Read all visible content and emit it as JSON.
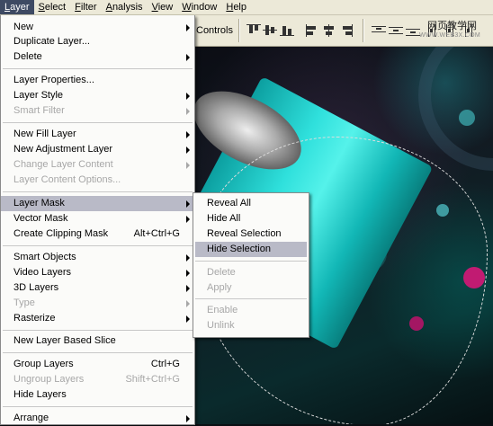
{
  "menubar": {
    "items": [
      {
        "label": "Layer",
        "mn": "L",
        "rest": "ayer",
        "active": true
      },
      {
        "label": "Select",
        "mn": "S",
        "rest": "elect"
      },
      {
        "label": "Filter",
        "mn": "F",
        "rest": "ilter"
      },
      {
        "label": "Analysis",
        "mn": "A",
        "rest": "nalysis"
      },
      {
        "label": "View",
        "mn": "V",
        "rest": "iew"
      },
      {
        "label": "Window",
        "mn": "W",
        "rest": "indow"
      },
      {
        "label": "Help",
        "mn": "H",
        "rest": "elp"
      }
    ]
  },
  "options": {
    "controls_label": "Controls"
  },
  "watermark": {
    "cn": "网页教学网",
    "url": "WWW.WEB3X.COM"
  },
  "layer_menu": {
    "new": "New",
    "duplicate_layer": "Duplicate Layer...",
    "delete": "Delete",
    "layer_properties": "Layer Properties...",
    "layer_style": "Layer Style",
    "smart_filter": "Smart Filter",
    "new_fill_layer": "New Fill Layer",
    "new_adjustment_layer": "New Adjustment Layer",
    "change_layer_content": "Change Layer Content",
    "layer_content_options": "Layer Content Options...",
    "layer_mask": "Layer Mask",
    "vector_mask": "Vector Mask",
    "create_clipping_mask": "Create Clipping Mask",
    "create_clipping_mask_shortcut": "Alt+Ctrl+G",
    "smart_objects": "Smart Objects",
    "video_layers": "Video Layers",
    "3d_layers": "3D Layers",
    "type": "Type",
    "rasterize": "Rasterize",
    "new_layer_based_slice": "New Layer Based Slice",
    "group_layers": "Group Layers",
    "group_layers_shortcut": "Ctrl+G",
    "ungroup_layers": "Ungroup Layers",
    "ungroup_layers_shortcut": "Shift+Ctrl+G",
    "hide_layers": "Hide Layers",
    "arrange": "Arrange"
  },
  "layer_mask_menu": {
    "reveal_all": "Reveal All",
    "hide_all": "Hide All",
    "reveal_selection": "Reveal Selection",
    "hide_selection": "Hide Selection",
    "delete": "Delete",
    "apply": "Apply",
    "enable": "Enable",
    "unlink": "Unlink"
  },
  "colors": {
    "menu_highlight": "#b9bac7",
    "menubar_active": "#3e4a63",
    "disabled_text": "#a7a7a7",
    "can_cyan": "#2fe0dc"
  }
}
